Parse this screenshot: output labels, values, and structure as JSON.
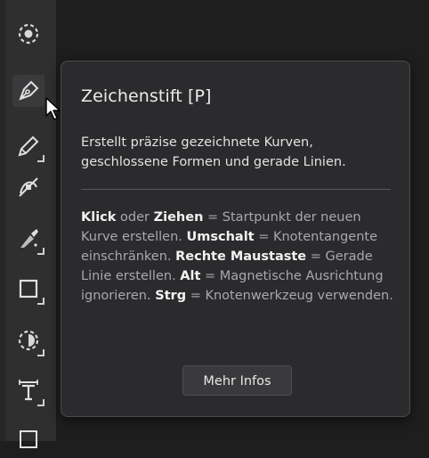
{
  "toolbar": {
    "tools": [
      {
        "icon": "selection-brush-icon"
      },
      {
        "icon": "pen-tool-icon"
      },
      {
        "icon": "pencil-tool-icon"
      },
      {
        "icon": "node-tool-icon"
      },
      {
        "icon": "vector-brush-icon"
      },
      {
        "icon": "rectangle-tool-icon"
      },
      {
        "icon": "transparency-tool-icon"
      },
      {
        "icon": "frame-text-tool-icon"
      }
    ]
  },
  "tooltip": {
    "title": "Zeichenstift [P]",
    "description": "Erstellt präzise gezeichnete Kurven, geschlossene Formen und gerade Linien.",
    "help": [
      {
        "bold": "Klick",
        "text": " oder "
      },
      {
        "bold": "Ziehen",
        "text": " = Startpunkt der neuen Kurve erstellen. "
      },
      {
        "bold": "Umschalt",
        "text": " = Knotentangente einschränken. "
      },
      {
        "bold": "Rechte Maustaste",
        "text": " = Gerade Linie erstellen. "
      },
      {
        "bold": "Alt",
        "text": " = Magnetische Ausrichtung ignorieren. "
      },
      {
        "bold": "Strg",
        "text": " = Knotenwerkzeug verwenden."
      }
    ],
    "button_label": "Mehr Infos"
  },
  "colors": {
    "background": "#1e1e1f",
    "toolbar": "#2f2f30",
    "tooltip": "#2b2b2d",
    "text": "#ececec",
    "muted_text": "#a9a9ab"
  }
}
